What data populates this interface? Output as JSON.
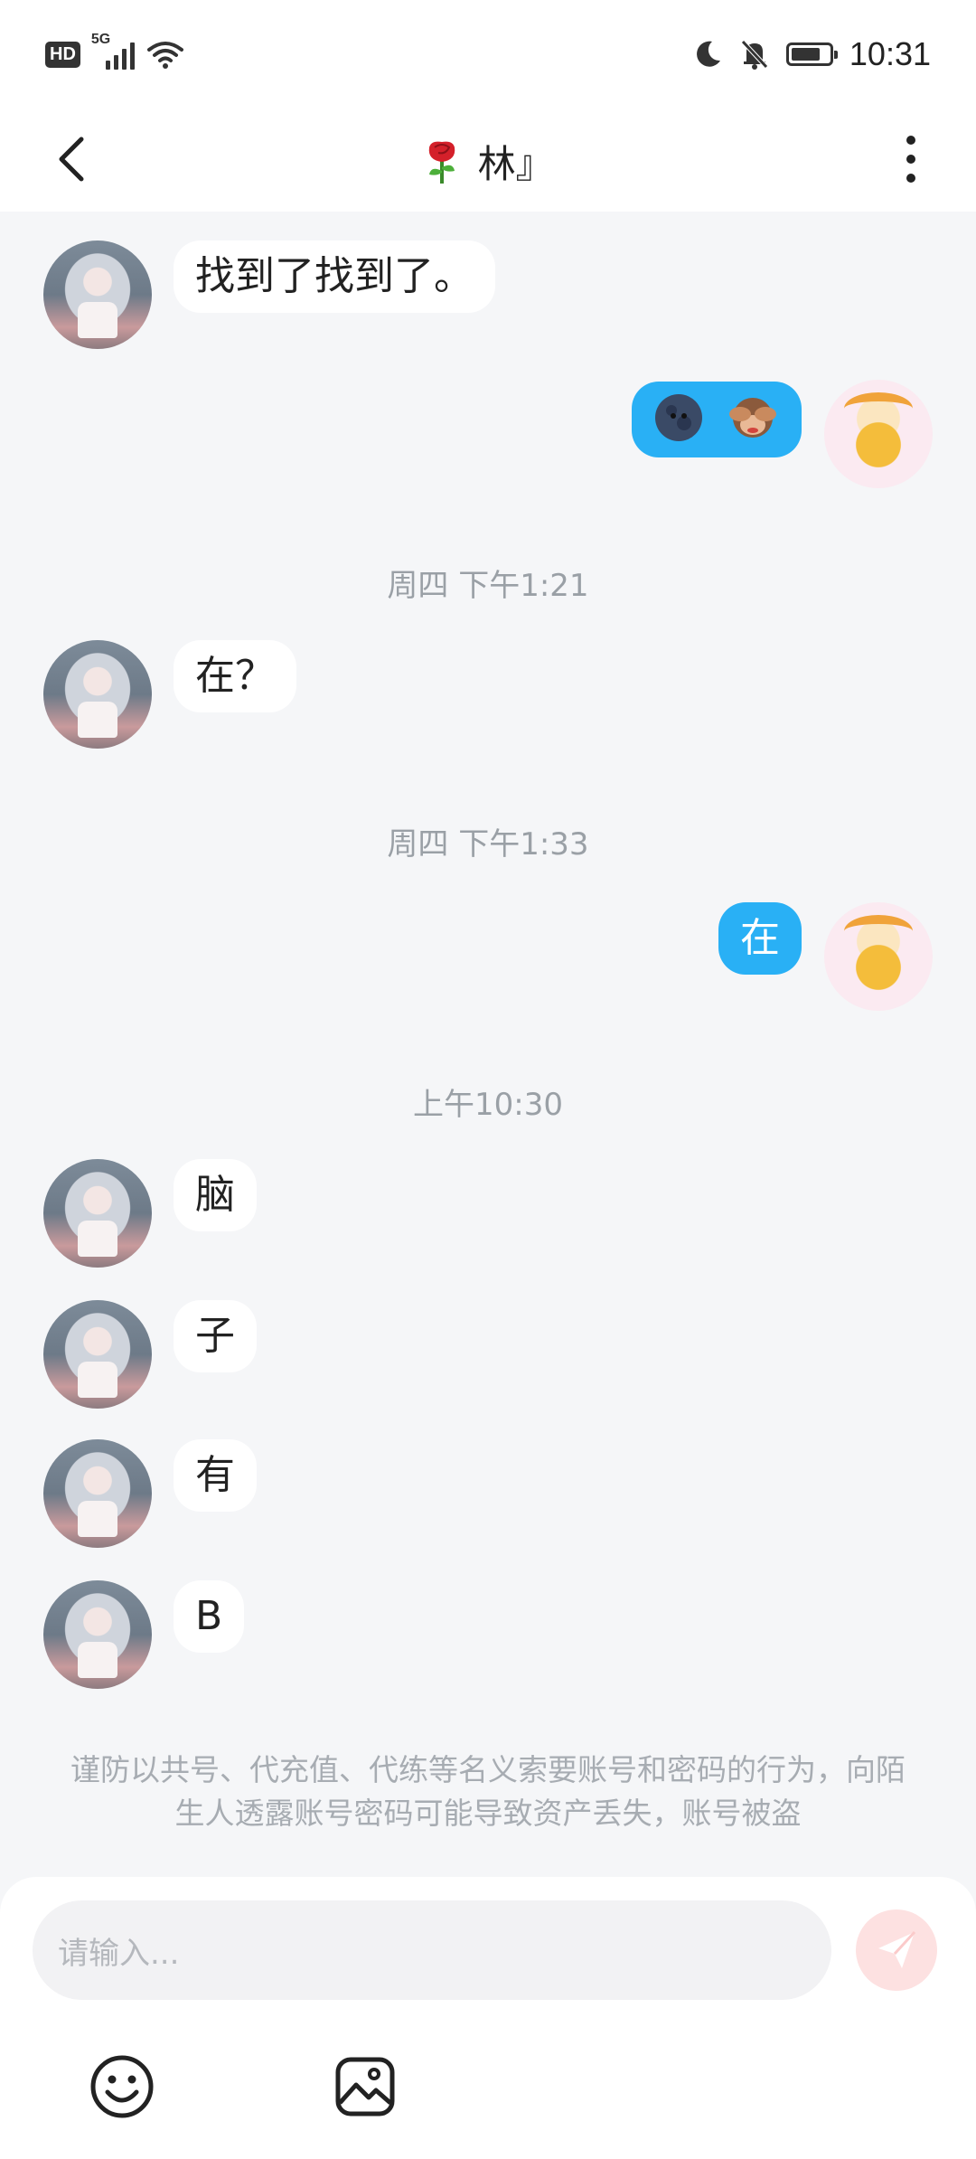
{
  "status_bar": {
    "network_badge": "HD",
    "network_type": "5G",
    "time": "10:31"
  },
  "header": {
    "title": "林』",
    "title_emoji": "rose",
    "back_icon": "chevron-left-icon",
    "menu_icon": "more-vertical-icon"
  },
  "messages": [
    {
      "type": "message",
      "side": "left",
      "text": "找到了找到了。"
    },
    {
      "type": "message",
      "side": "right",
      "emoji": [
        "new-moon-face",
        "see-no-evil-monkey"
      ]
    },
    {
      "type": "timestamp",
      "text": "周四 下午1:21"
    },
    {
      "type": "message",
      "side": "left",
      "text": "在？"
    },
    {
      "type": "timestamp",
      "text": "周四 下午1:33"
    },
    {
      "type": "message",
      "side": "right",
      "text": "在"
    },
    {
      "type": "timestamp",
      "text": "上午10:30"
    },
    {
      "type": "message",
      "side": "left",
      "text": "脑"
    },
    {
      "type": "message",
      "side": "left",
      "text": "子"
    },
    {
      "type": "message",
      "side": "left",
      "text": "有"
    },
    {
      "type": "message",
      "side": "left",
      "text": "B"
    }
  ],
  "warning": "谨防以共号、代充值、代练等名义索要账号和密码的行为，向陌生人透露账号密码可能导致资产丢失，账号被盗",
  "composer": {
    "placeholder": "请输入...",
    "send_icon": "send-icon",
    "emoji_icon": "smiley-icon",
    "image_icon": "image-icon"
  },
  "colors": {
    "outgoing_bubble": "#29b0f5",
    "incoming_bubble": "#ffffff",
    "chat_background": "#f5f6f8",
    "send_button_disabled": "#fde1e1"
  }
}
